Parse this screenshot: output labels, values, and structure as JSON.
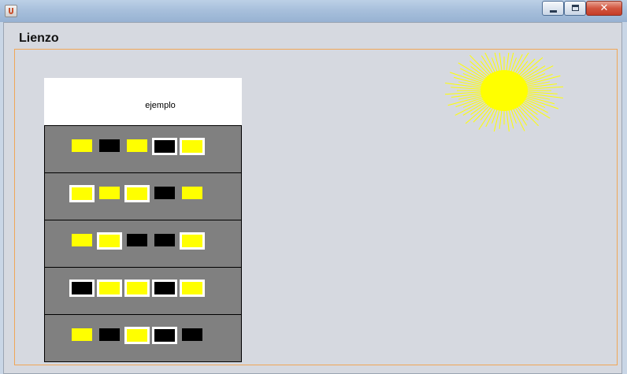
{
  "window": {
    "minimize_label": "",
    "maximize_label": "",
    "close_label": "✕"
  },
  "panel": {
    "title": "Lienzo"
  },
  "building": {
    "label": "ejemplo",
    "floors": [
      {
        "windows": [
          {
            "lit": true,
            "framed": false
          },
          {
            "lit": false,
            "framed": false
          },
          {
            "lit": true,
            "framed": false
          },
          {
            "lit": false,
            "framed": true
          },
          {
            "lit": true,
            "framed": true
          }
        ]
      },
      {
        "windows": [
          {
            "lit": true,
            "framed": true
          },
          {
            "lit": true,
            "framed": false
          },
          {
            "lit": true,
            "framed": true
          },
          {
            "lit": false,
            "framed": false
          },
          {
            "lit": true,
            "framed": false
          }
        ]
      },
      {
        "windows": [
          {
            "lit": true,
            "framed": false
          },
          {
            "lit": true,
            "framed": true
          },
          {
            "lit": false,
            "framed": false
          },
          {
            "lit": false,
            "framed": false
          },
          {
            "lit": true,
            "framed": true
          }
        ]
      },
      {
        "windows": [
          {
            "lit": false,
            "framed": true
          },
          {
            "lit": true,
            "framed": true
          },
          {
            "lit": true,
            "framed": true
          },
          {
            "lit": false,
            "framed": true
          },
          {
            "lit": true,
            "framed": true
          }
        ]
      },
      {
        "windows": [
          {
            "lit": true,
            "framed": false
          },
          {
            "lit": false,
            "framed": false
          },
          {
            "lit": true,
            "framed": true
          },
          {
            "lit": false,
            "framed": true
          },
          {
            "lit": false,
            "framed": false
          }
        ]
      }
    ]
  },
  "colors": {
    "lit": "#ffff00",
    "dark": "#000000",
    "floor": "#808080",
    "sun": "#ffff00",
    "canvas_border": "#f0a656"
  },
  "icons": {
    "app": "java-cup-icon",
    "sun": "sun-icon"
  }
}
